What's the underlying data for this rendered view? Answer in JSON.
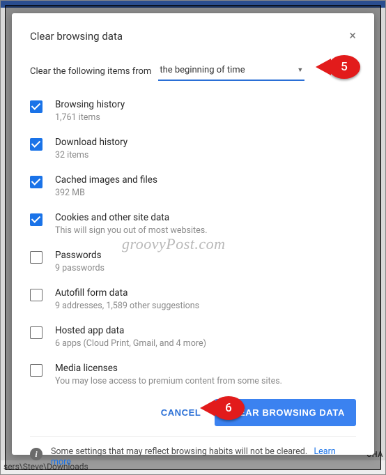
{
  "annotations": {
    "marker5": "5",
    "marker6": "6"
  },
  "watermark": "groovyPost.com",
  "dialog": {
    "title": "Clear browsing data",
    "close_glyph": "×",
    "time_label": "Clear the following items from",
    "time_value": "the beginning of time",
    "items": [
      {
        "checked": true,
        "label": "Browsing history",
        "sub": "1,761 items"
      },
      {
        "checked": true,
        "label": "Download history",
        "sub": "32 items"
      },
      {
        "checked": true,
        "label": "Cached images and files",
        "sub": "392 MB"
      },
      {
        "checked": true,
        "label": "Cookies and other site data",
        "sub": "This will sign you out of most websites."
      },
      {
        "checked": false,
        "label": "Passwords",
        "sub": "9 passwords"
      },
      {
        "checked": false,
        "label": "Autofill form data",
        "sub": "9 addresses, 1,589 other suggestions"
      },
      {
        "checked": false,
        "label": "Hosted app data",
        "sub": "6 apps (Cloud Print, Gmail, and 4 more)"
      },
      {
        "checked": false,
        "label": "Media licenses",
        "sub": "You may lose access to premium content from some sites."
      }
    ],
    "cancel_label": "CANCEL",
    "clear_label": "CLEAR BROWSING DATA",
    "footer_text": "Some settings that may reflect browsing habits will not be cleared.",
    "learn_more": "Learn more",
    "info_glyph": "i"
  },
  "background": {
    "path": "sers\\Steve\\Downloads",
    "change": "CHA"
  }
}
